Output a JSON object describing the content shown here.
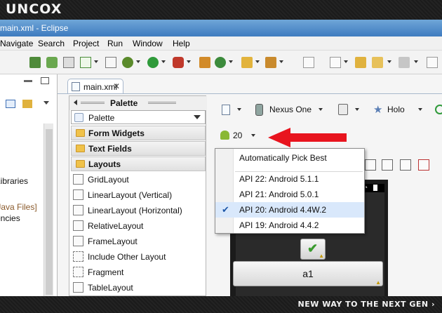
{
  "branding": {
    "logo": "UNCOX",
    "tagline": "NEW WAY TO THE NEXT GEN ›"
  },
  "window": {
    "title": "main.xml - Eclipse"
  },
  "menubar": {
    "items": [
      "Navigate",
      "Search",
      "Project",
      "Run",
      "Window",
      "Help"
    ]
  },
  "left_panel": {
    "items": [
      "Libraries",
      "[Java Files]",
      "encies"
    ]
  },
  "editor": {
    "tab_label": "main.xml"
  },
  "palette": {
    "header": "Palette",
    "selector_value": "Palette",
    "categories": [
      "Form Widgets",
      "Text Fields",
      "Layouts"
    ],
    "items": [
      "GridLayout",
      "LinearLayout (Vertical)",
      "LinearLayout (Horizontal)",
      "RelativeLayout",
      "FrameLayout",
      "Include Other Layout",
      "Fragment",
      "TableLayout"
    ]
  },
  "layout_toolbar": {
    "device": "Nexus One",
    "theme": "Holo",
    "api_level": "20"
  },
  "api_menu": {
    "items": [
      {
        "label": "Automatically Pick Best",
        "checked": false
      },
      {
        "label": "API 22: Android 5.1.1",
        "checked": false
      },
      {
        "label": "API 21: Android 5.0.1",
        "checked": false
      },
      {
        "label": "API 20: Android 4.4W.2",
        "checked": true
      },
      {
        "label": "API 19: Android 4.4.2",
        "checked": false
      }
    ]
  },
  "preview": {
    "button_label": "a1"
  },
  "colors": {
    "arrow": "#e8141e",
    "title_bar": "#3e7bbf",
    "selection": "#d9e8fb",
    "android_green": "#8ab833"
  }
}
